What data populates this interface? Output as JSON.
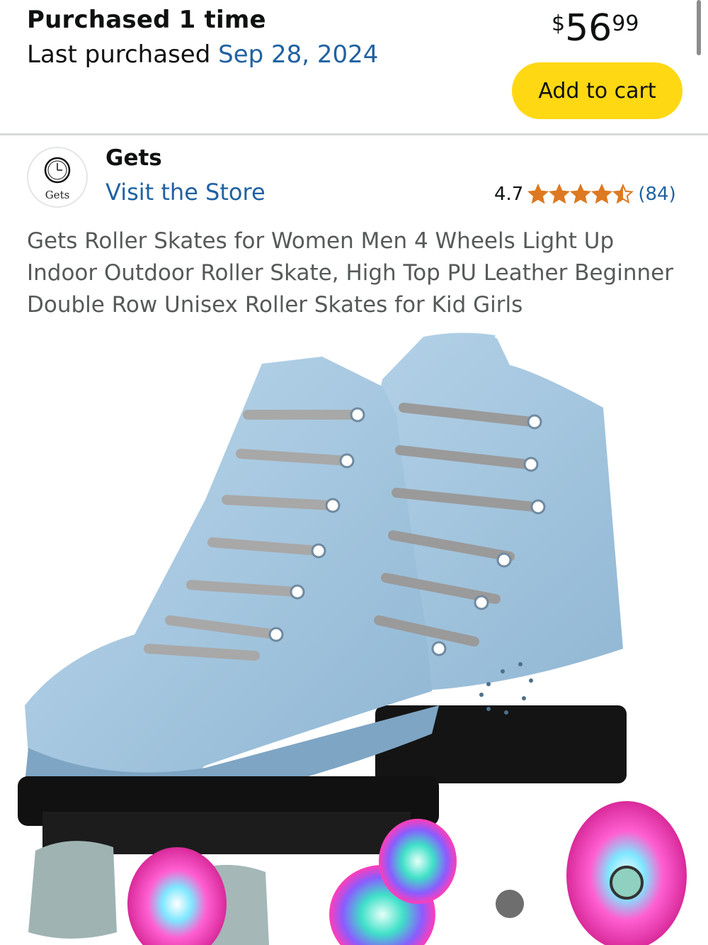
{
  "order": {
    "purchased_count": "Purchased 1 time",
    "last_purchased_label": "Last purchased",
    "last_purchased_date": "Sep 28, 2024"
  },
  "price": {
    "symbol": "$",
    "whole": "56",
    "fraction": "99"
  },
  "actions": {
    "add_to_cart": "Add to cart"
  },
  "store": {
    "logo_text": "Gets",
    "name": "Gets",
    "visit_link": "Visit the Store"
  },
  "rating": {
    "value": "4.7",
    "count": "(84)",
    "stars_filled": 4.5,
    "stars_total": 5,
    "star_color": "#de7921"
  },
  "product": {
    "title": "Gets Roller Skates for Women Men 4 Wheels Light Up Indoor Outdoor Roller Skate, High Top PU Leather Beginner Double Row Unisex Roller Skates for Kid Girls"
  },
  "colors": {
    "link": "#2162a1",
    "button": "#ffd814",
    "text": "#0f1111",
    "muted": "#565959"
  }
}
